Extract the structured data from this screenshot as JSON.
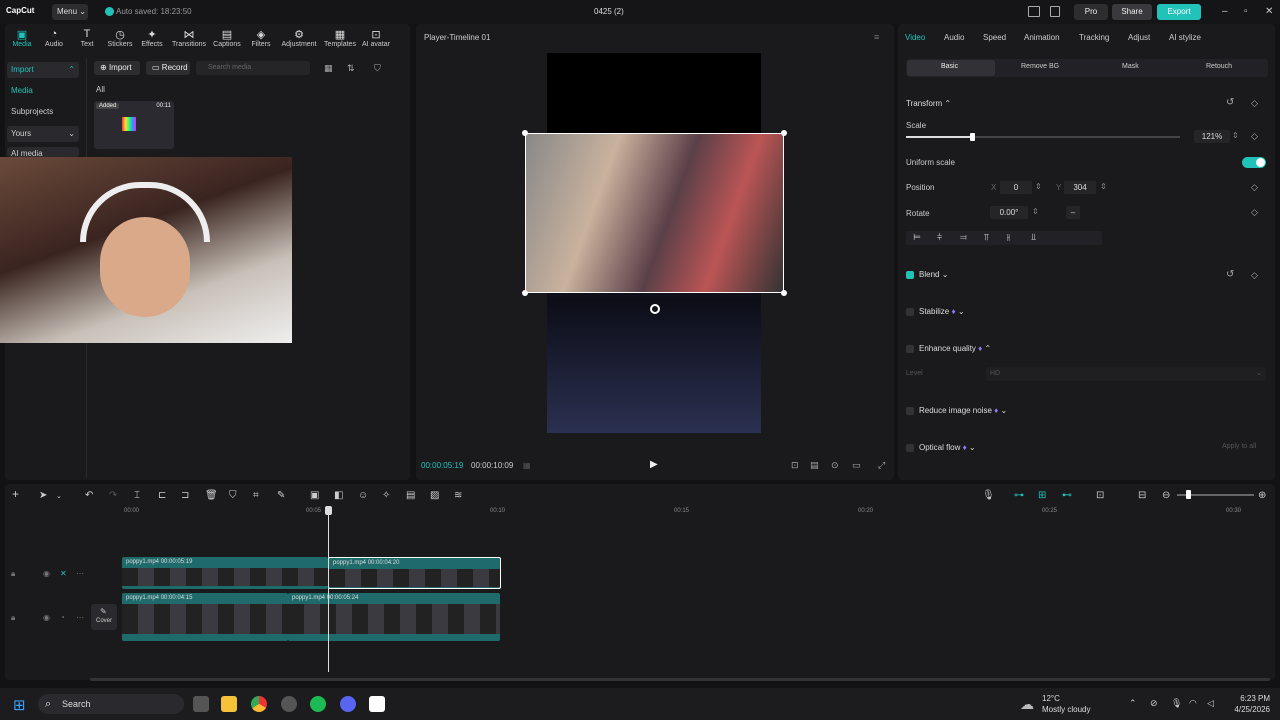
{
  "app": {
    "logo": "CapCut",
    "menu_label": "Menu",
    "autosave": "Auto saved: 18:23:50",
    "project_title": "0425 (2)",
    "pro_label": "Pro",
    "share_label": "Share",
    "export_label": "Export"
  },
  "toolbar": {
    "items": [
      "Media",
      "Audio",
      "Text",
      "Stickers",
      "Effects",
      "Transitions",
      "Captions",
      "Filters",
      "Adjustment",
      "Templates",
      "AI avatar"
    ]
  },
  "sidenav": {
    "import": "Import",
    "media": "Media",
    "subprojects": "Subprojects",
    "yours": "Yours",
    "ai_media": "AI media"
  },
  "media_panel": {
    "import_btn": "Import",
    "record_btn": "Record",
    "search_placeholder": "Search media",
    "filter_all": "All",
    "thumb_badge": "Added",
    "thumb_duration": "00:11"
  },
  "player": {
    "title": "Player-Timeline 01",
    "current_time": "00:00:05:19",
    "total_time": "00:00:10:09"
  },
  "right_panel": {
    "tabs": [
      "Video",
      "Audio",
      "Speed",
      "Animation",
      "Tracking",
      "Adjust",
      "AI stylize"
    ],
    "subtabs": [
      "Basic",
      "Remove BG",
      "Mask",
      "Retouch"
    ],
    "transform": "Transform",
    "scale_label": "Scale",
    "scale_value": "121%",
    "scale_level": 0.121,
    "uniform_scale": "Uniform scale",
    "position_label": "Position",
    "pos_x_label": "X",
    "pos_x": "0",
    "pos_y_label": "Y",
    "pos_y": "304",
    "rotate_label": "Rotate",
    "rotate_value": "0.00°",
    "blend": "Blend",
    "stabilize": "Stabilize",
    "enhance_quality": "Enhance quality",
    "level_label": "Level",
    "level_value": "HD",
    "reduce_noise": "Reduce image noise",
    "optical_flow": "Optical flow",
    "apply_all": "Apply to all"
  },
  "timeline": {
    "ruler": [
      "00:00",
      "00:05",
      "00:10",
      "00:15",
      "00:20",
      "00:25",
      "00:30"
    ],
    "cover_label": "Cover",
    "clips": {
      "top1_name": "poppy1.mp4",
      "top1_dur": "00:00:05:19",
      "top2_name": "poppy1.mp4",
      "top2_dur": "00:00:04:20",
      "bot1_name": "poppy1.mp4",
      "bot1_dur": "00:00:04:15",
      "bot2_name": "poppy1.mp4",
      "bot2_dur": "00:00:05:24"
    }
  },
  "taskbar": {
    "search": "Search",
    "temp": "12°C",
    "weather": "Mostly cloudy",
    "time": "6:23 PM",
    "date": "4/25/2026"
  }
}
